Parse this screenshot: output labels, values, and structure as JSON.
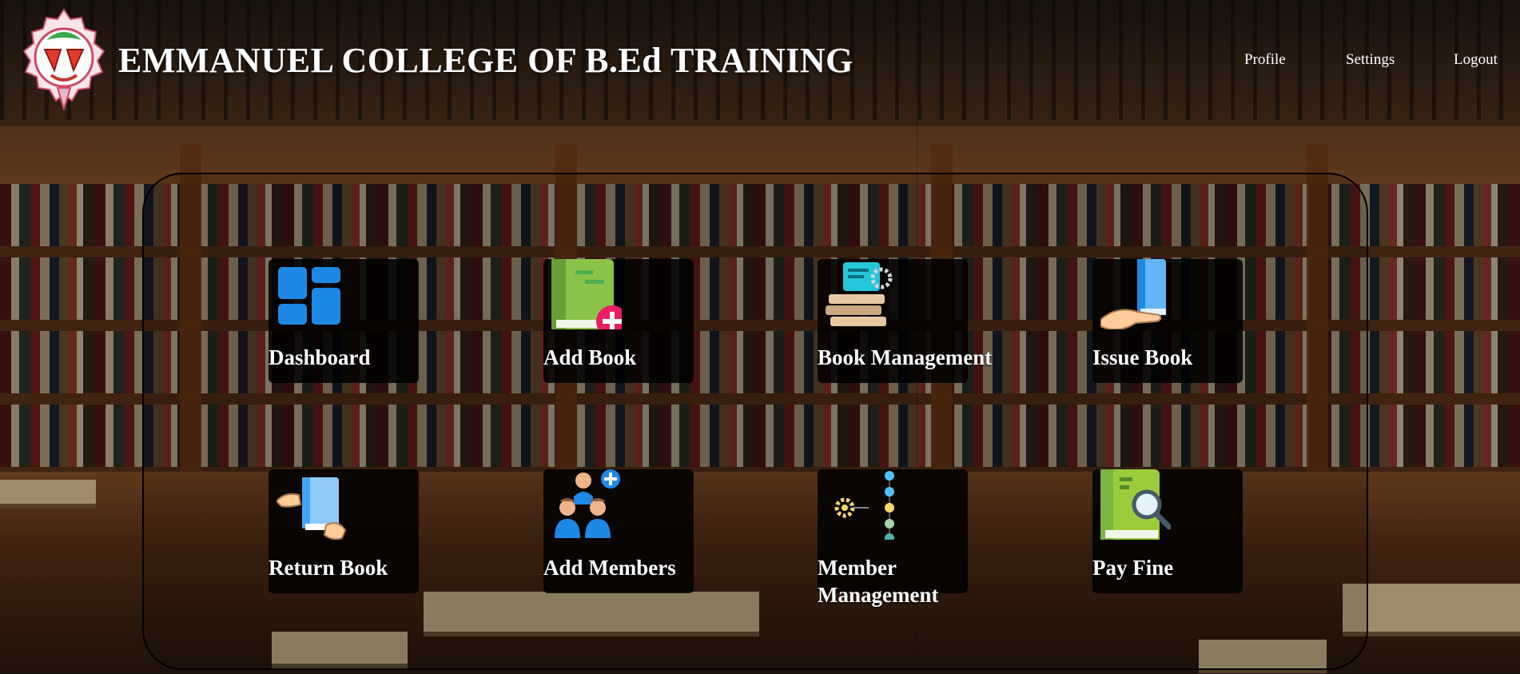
{
  "header": {
    "title": "EMMANUEL COLLEGE OF B.Ed TRAINING",
    "nav": {
      "profile": "Profile",
      "settings": "Settings",
      "logout": "Logout"
    }
  },
  "tiles": [
    {
      "label": "Dashboard",
      "icon": "dashboard-icon"
    },
    {
      "label": "Add Book",
      "icon": "add-book-icon"
    },
    {
      "label": "Book Management",
      "icon": "book-management-icon"
    },
    {
      "label": "Issue Book",
      "icon": "issue-book-icon"
    },
    {
      "label": "Return Book",
      "icon": "return-book-icon"
    },
    {
      "label": "Add Members",
      "icon": "add-members-icon"
    },
    {
      "label": "Member Management",
      "icon": "member-management-icon"
    },
    {
      "label": "Pay Fine",
      "icon": "pay-fine-icon"
    }
  ],
  "colors": {
    "tile_bg": "#000000",
    "text": "#ffffff",
    "accent_blue": "#1e88e5",
    "accent_green": "#8bc34a"
  }
}
